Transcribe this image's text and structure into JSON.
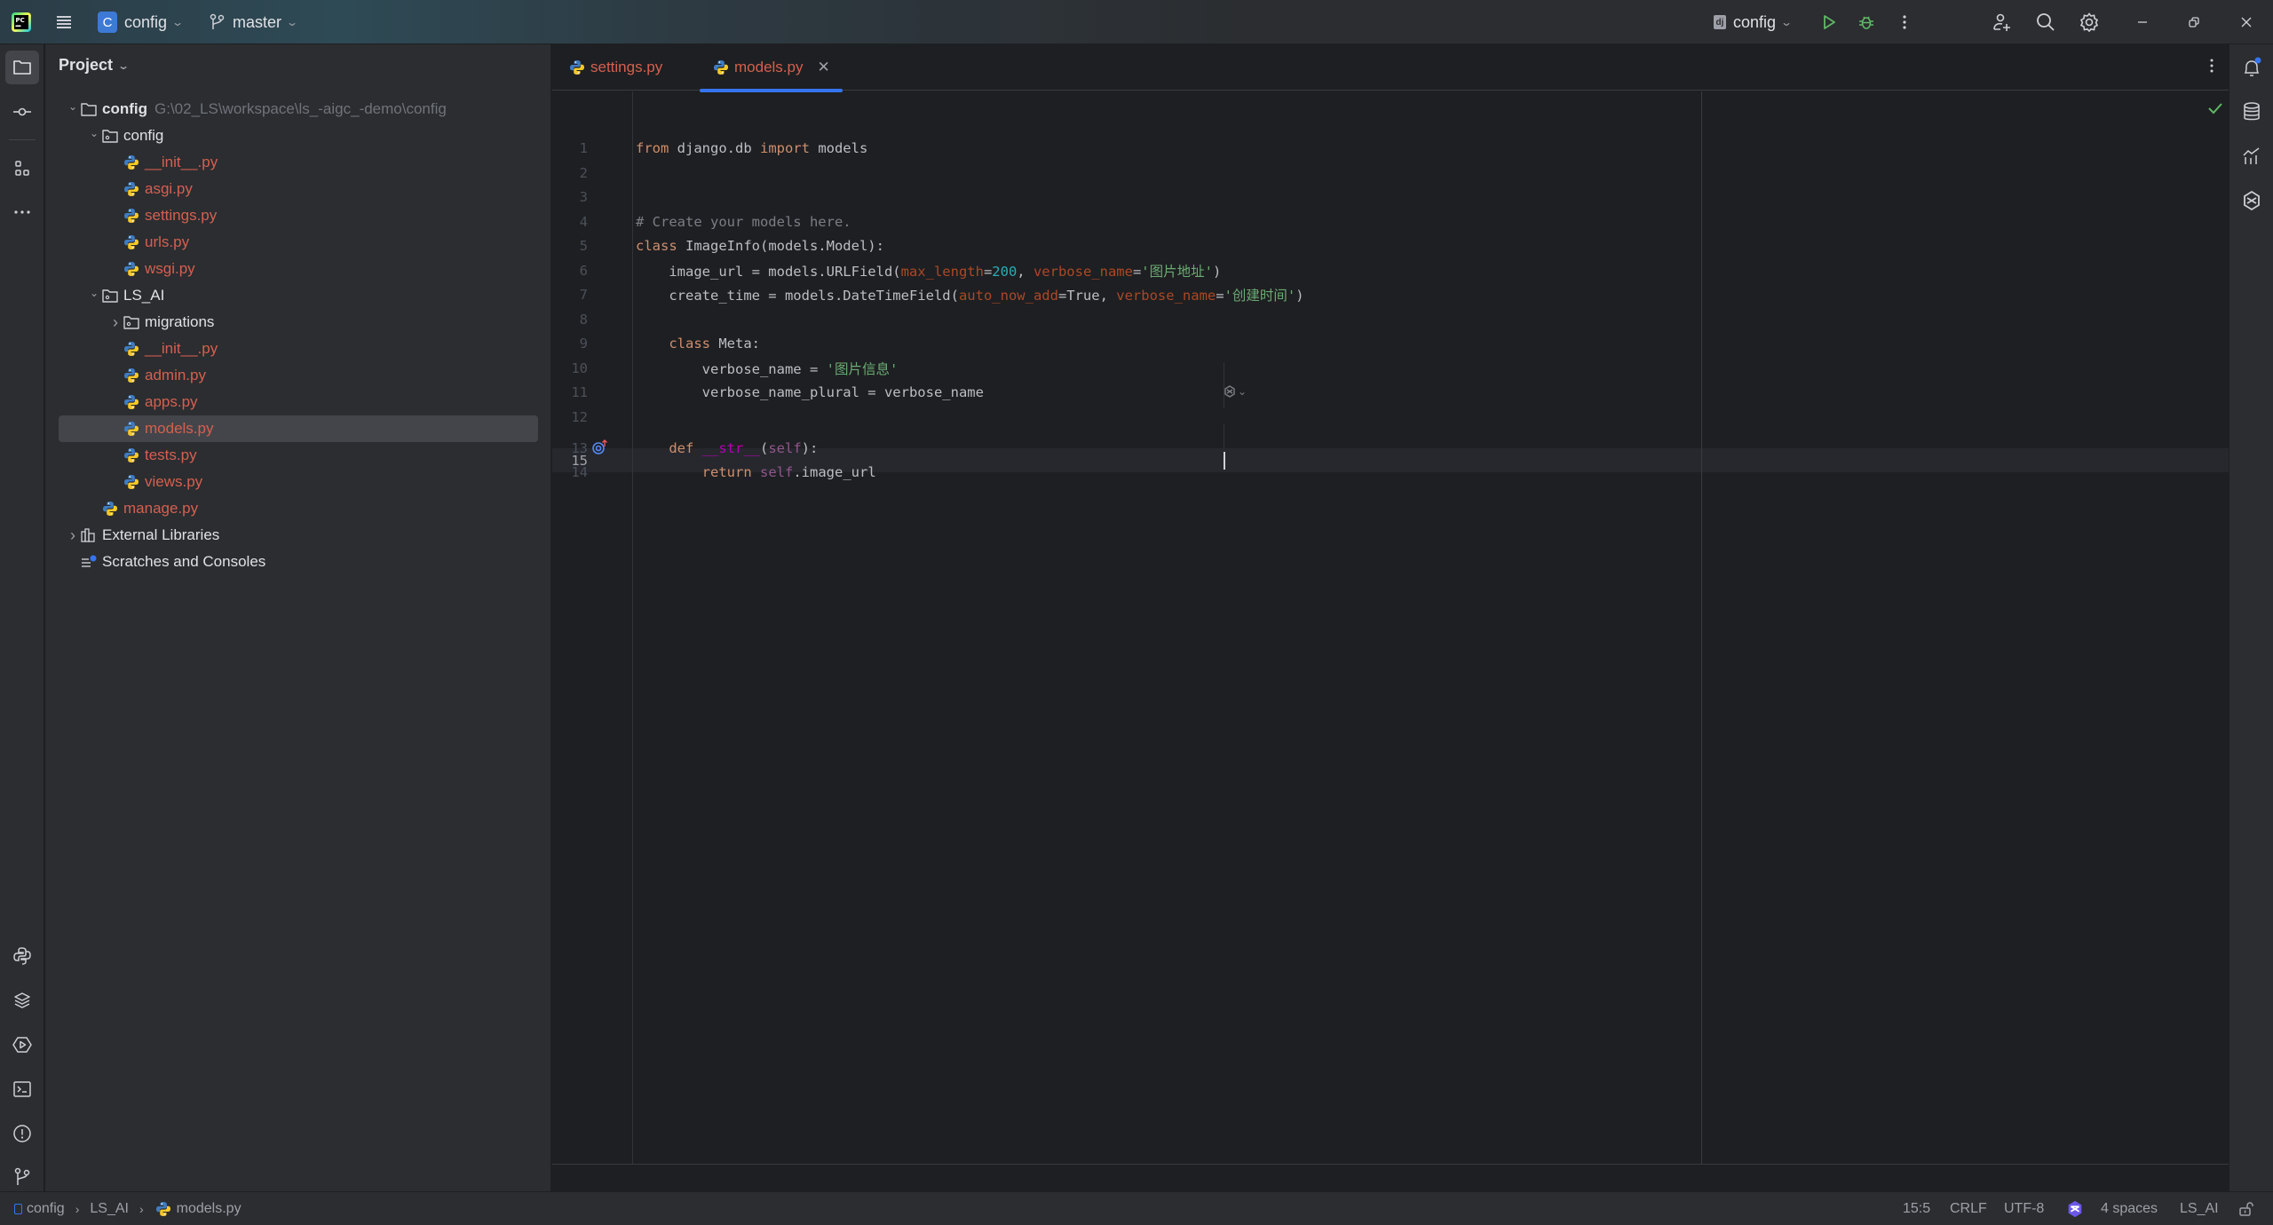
{
  "titlebar": {
    "project_badge": "C",
    "project_name": "config",
    "branch": "master",
    "run_config": "config",
    "run_config_icon": "django-icon"
  },
  "project_panel": {
    "title": "Project",
    "tree": [
      {
        "label": "config",
        "hint": "G:\\02_LS\\workspace\\ls_-aigc_-demo\\config",
        "type": "root",
        "expanded": true
      },
      {
        "label": "config",
        "type": "package",
        "expanded": true
      },
      {
        "label": "__init__.py",
        "type": "py"
      },
      {
        "label": "asgi.py",
        "type": "py"
      },
      {
        "label": "settings.py",
        "type": "py"
      },
      {
        "label": "urls.py",
        "type": "py"
      },
      {
        "label": "wsgi.py",
        "type": "py"
      },
      {
        "label": "LS_AI",
        "type": "package",
        "expanded": true
      },
      {
        "label": "migrations",
        "type": "package",
        "expanded": false
      },
      {
        "label": "__init__.py",
        "type": "py"
      },
      {
        "label": "admin.py",
        "type": "py"
      },
      {
        "label": "apps.py",
        "type": "py"
      },
      {
        "label": "models.py",
        "type": "py",
        "selected": true
      },
      {
        "label": "tests.py",
        "type": "py"
      },
      {
        "label": "views.py",
        "type": "py"
      },
      {
        "label": "manage.py",
        "type": "py"
      },
      {
        "label": "External Libraries",
        "type": "libraries",
        "expanded": false
      },
      {
        "label": "Scratches and Consoles",
        "type": "scratches"
      }
    ]
  },
  "editor": {
    "tabs": [
      {
        "label": "settings.py",
        "active": false
      },
      {
        "label": "models.py",
        "active": true
      }
    ],
    "lines": [
      {
        "n": "1",
        "text": "from django.db import models"
      },
      {
        "n": "2",
        "text": ""
      },
      {
        "n": "3",
        "text": ""
      },
      {
        "n": "4",
        "text": "# Create your models here."
      },
      {
        "n": "5",
        "text": "class ImageInfo(models.Model):"
      },
      {
        "n": "6",
        "text": "    image_url = models.URLField(max_length=200, verbose_name='图片地址')"
      },
      {
        "n": "7",
        "text": "    create_time = models.DateTimeField(auto_now_add=True, verbose_name='创建时间')"
      },
      {
        "n": "8",
        "text": ""
      },
      {
        "n": "9",
        "text": "    class Meta:"
      },
      {
        "n": "10",
        "text": "        verbose_name = '图片信息'"
      },
      {
        "n": "11",
        "text": "        verbose_name_plural = verbose_name"
      },
      {
        "n": "12",
        "text": ""
      },
      {
        "n": "13",
        "text": "    def __str__(self):"
      },
      {
        "n": "14",
        "text": "        return self.image_url"
      },
      {
        "n": "15",
        "text": ""
      }
    ],
    "tokens": {
      "l1": [
        "from",
        " django.db ",
        "import",
        " models"
      ],
      "l4": "# Create your models here.",
      "l5": [
        "class",
        " ImageInfo(models.Model):"
      ],
      "l6": [
        "    image_url = models.URLField(",
        "max_length",
        "=",
        "200",
        ", ",
        "verbose_name",
        "=",
        "'图片地址'",
        ")"
      ],
      "l7": [
        "    create_time = models.DateTimeField(",
        "auto_now_add",
        "=True, ",
        "verbose_name",
        "=",
        "'创建时间'",
        ")"
      ],
      "l9": [
        "    ",
        "class",
        " Meta:"
      ],
      "l10": [
        "        verbose_name = ",
        "'图片信息'"
      ],
      "l11": "        verbose_name_plural = verbose_name",
      "l13": [
        "    ",
        "def",
        " ",
        "__str__",
        "(",
        "self",
        "):"
      ],
      "l14": [
        "        ",
        "return",
        " ",
        "self",
        ".image_url"
      ]
    },
    "current_line": 15,
    "inspection_status": "no-problems"
  },
  "breadcrumb": [
    "config",
    "LS_AI",
    "models.py"
  ],
  "statusbar": {
    "position": "15:5",
    "line_separator": "CRLF",
    "encoding": "UTF-8",
    "indent": "4 spaces",
    "interpreter": "LS_AI"
  },
  "colors": {
    "accent": "#3574f0",
    "modified_file": "#d5604f",
    "string": "#6aab73",
    "keyword": "#cf8e6d",
    "number": "#2aacb8",
    "run_green": "#5fb865"
  }
}
